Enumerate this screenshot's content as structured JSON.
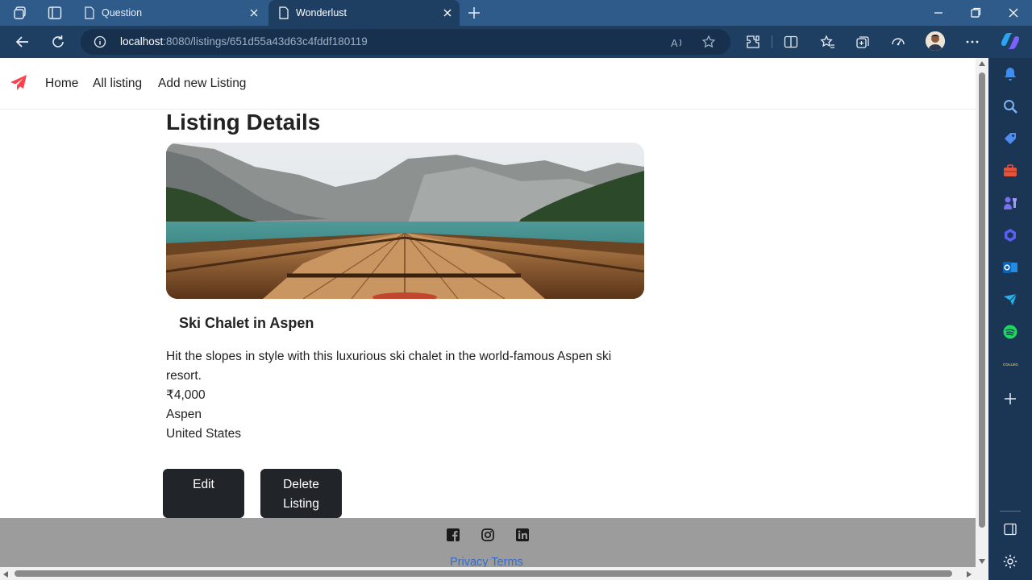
{
  "browser": {
    "tabs": [
      {
        "title": "Question",
        "active": false
      },
      {
        "title": "Wonderlust",
        "active": true
      }
    ],
    "url_host": "localhost",
    "url_rest": ":8080/listings/651d55a43d63c4fddf180119"
  },
  "navbar": {
    "brand_icon": "paper-plane-icon",
    "links": [
      "Home",
      "All listing",
      "Add new Listing"
    ]
  },
  "page": {
    "heading": "Listing Details",
    "listing_title": "Ski Chalet in Aspen",
    "description_line1": "Hit the slopes in style with this luxurious ski chalet in the world-famous Aspen ski",
    "description_line2": "resort.",
    "price": "₹4,000",
    "location": "Aspen",
    "country": "United States",
    "edit_label": "Edit",
    "delete_line1": "Delete",
    "delete_line2": "Listing"
  },
  "footer": {
    "icons": [
      "facebook-icon",
      "instagram-icon",
      "linkedin-icon"
    ],
    "links": "Privacy Terms"
  },
  "colors": {
    "brand": "#fe424d",
    "button": "#212529",
    "footer_bg": "#9c9c9c",
    "link": "#2f6bd4",
    "tabbar": "#2f5b8a"
  }
}
